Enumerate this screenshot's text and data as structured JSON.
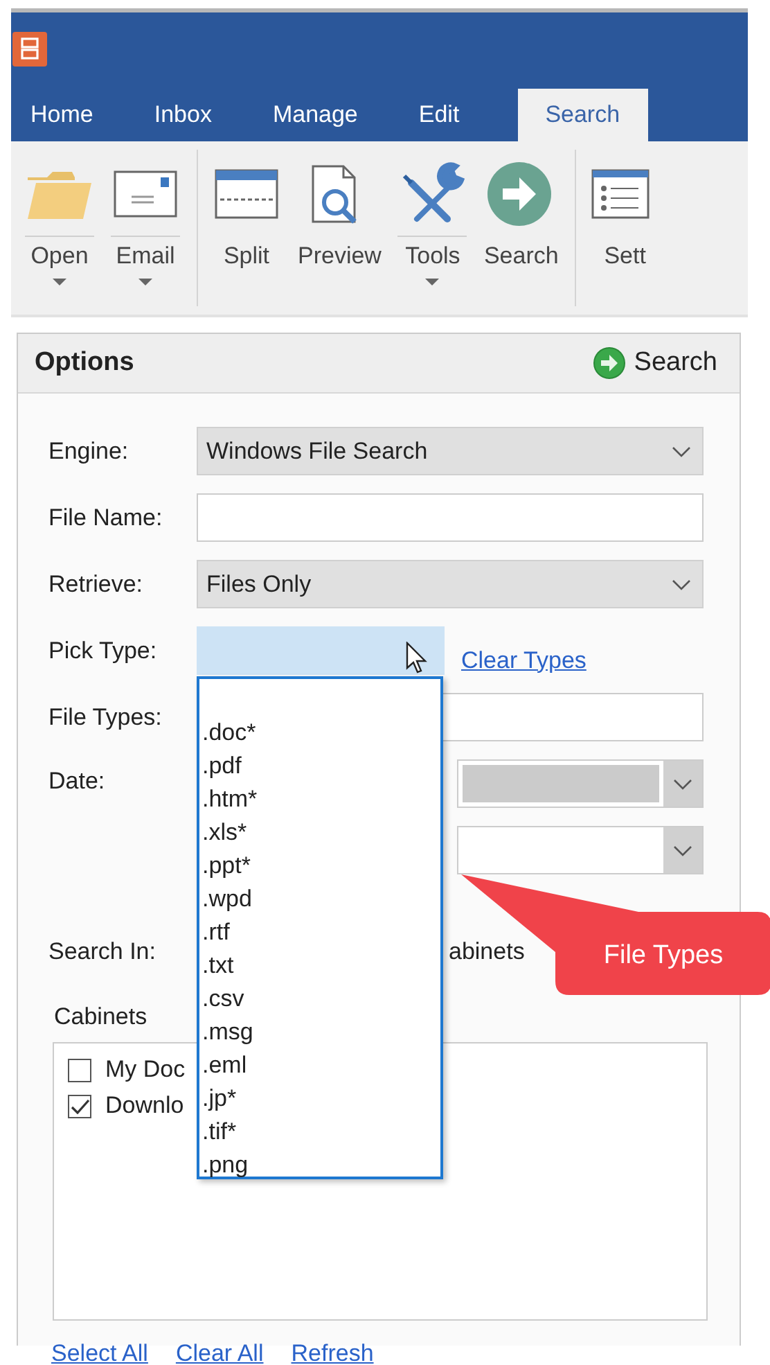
{
  "tabs": [
    {
      "label": "Home",
      "selected": false
    },
    {
      "label": "Inbox",
      "selected": false
    },
    {
      "label": "Manage",
      "selected": false
    },
    {
      "label": "Edit",
      "selected": false
    },
    {
      "label": "Search",
      "selected": true
    }
  ],
  "ribbon": {
    "groups": [
      [
        {
          "label": "Open",
          "kind": "folder",
          "has_menu": true
        },
        {
          "label": "Email",
          "kind": "envelope",
          "has_menu": true
        }
      ],
      [
        {
          "label": "Split",
          "kind": "split",
          "has_menu": false
        },
        {
          "label": "Preview",
          "kind": "preview",
          "has_menu": false
        },
        {
          "label": "Tools",
          "kind": "tools",
          "has_menu": true
        },
        {
          "label": "Search",
          "kind": "go",
          "has_menu": false
        }
      ],
      [
        {
          "label": "Sett",
          "kind": "list",
          "has_menu": false
        }
      ]
    ]
  },
  "options": {
    "title": "Options",
    "search_button": "Search",
    "fields": [
      {
        "kind": "select",
        "label": "Engine:",
        "value": "Windows File Search"
      },
      {
        "kind": "input",
        "label": "File Name:"
      },
      {
        "kind": "select",
        "label": "Retrieve:",
        "value": "Files Only"
      },
      {
        "kind": "picker",
        "label": "Pick Type:",
        "expanded": true,
        "link": "Clear Types"
      },
      {
        "kind": "input",
        "label": "File Types:"
      },
      {
        "kind": "date",
        "label": "Date:",
        "disabled": true
      }
    ],
    "search_in": {
      "label": "Search In:",
      "option": "abinets"
    },
    "cabinets": {
      "label": "Cabinets",
      "items": [
        {
          "label": "My Doc",
          "checked": false
        },
        {
          "label": "Downlo",
          "checked": true
        }
      ]
    },
    "links": [
      "Select All",
      "Clear All",
      "Refresh"
    ]
  },
  "dropdown": {
    "options": [
      ".doc*",
      ".pdf",
      ".htm*",
      ".xls*",
      ".ppt*",
      ".wpd",
      ".rtf",
      ".txt",
      ".csv",
      ".msg",
      ".eml",
      ".jp*",
      ".tif*",
      ".png"
    ]
  },
  "callout": {
    "text": "File Types"
  }
}
